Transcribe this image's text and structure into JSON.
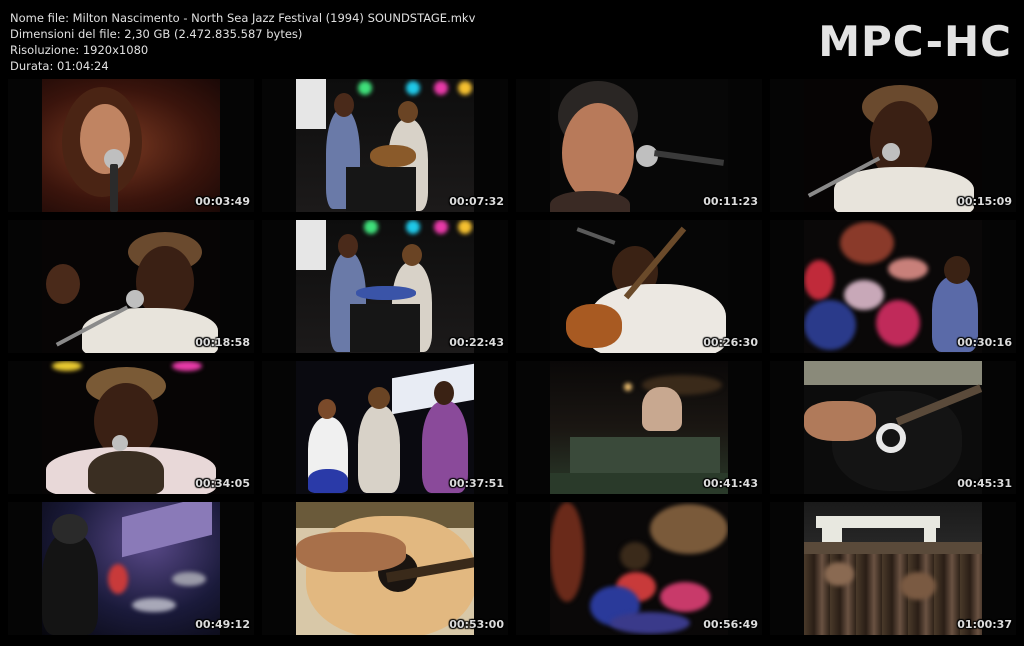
{
  "header": {
    "file_name": "Nome file: Milton Nascimento - North Sea Jazz Festival (1994) SOUNDSTAGE.mkv",
    "file_size": "Dimensioni del file: 2,30 GB (2.472.835.587 bytes)",
    "resolution": "Risoluzione: 1920x1080",
    "duration": "Durata: 01:04:24"
  },
  "logo": "MPC-HC",
  "thumbnails": [
    {
      "time": "00:03:49",
      "scene": "closeup-singer"
    },
    {
      "time": "00:07:32",
      "scene": "stage-band"
    },
    {
      "time": "00:11:23",
      "scene": "closeup-singer-mic"
    },
    {
      "time": "00:15:09",
      "scene": "singer-cap"
    },
    {
      "time": "00:18:58",
      "scene": "singer-cap-arm"
    },
    {
      "time": "00:22:43",
      "scene": "stage-band"
    },
    {
      "time": "00:26:30",
      "scene": "guitarist"
    },
    {
      "time": "00:30:16",
      "scene": "drummer"
    },
    {
      "time": "00:34:05",
      "scene": "singer-cap-mic"
    },
    {
      "time": "00:37:51",
      "scene": "stage-three"
    },
    {
      "time": "00:41:43",
      "scene": "dark-stage"
    },
    {
      "time": "00:45:31",
      "scene": "guitar-closeup"
    },
    {
      "time": "00:49:12",
      "scene": "drums-blue"
    },
    {
      "time": "00:53:00",
      "scene": "acoustic-guitar"
    },
    {
      "time": "00:56:49",
      "scene": "drums-cymbals"
    },
    {
      "time": "01:00:37",
      "scene": "crowd-banner"
    }
  ]
}
